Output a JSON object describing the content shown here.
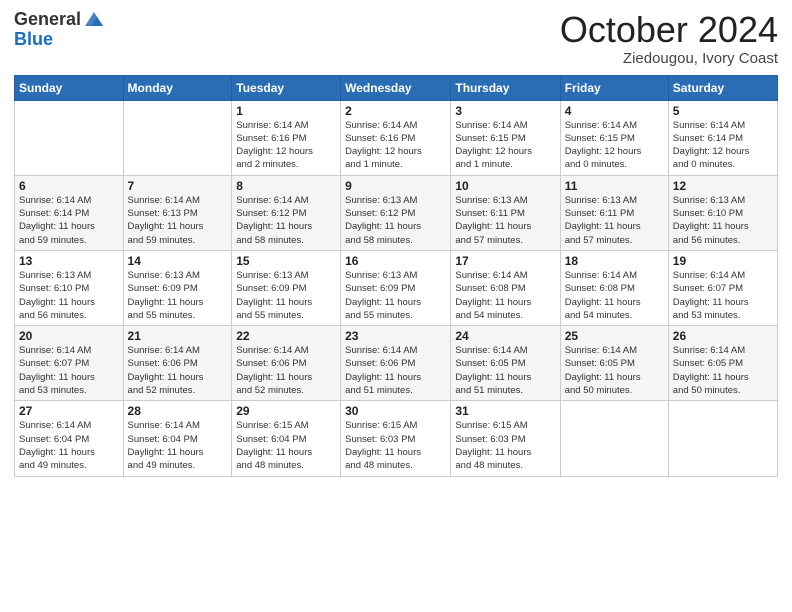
{
  "header": {
    "logo_general": "General",
    "logo_blue": "Blue",
    "month_title": "October 2024",
    "location": "Ziedougou, Ivory Coast"
  },
  "weekdays": [
    "Sunday",
    "Monday",
    "Tuesday",
    "Wednesday",
    "Thursday",
    "Friday",
    "Saturday"
  ],
  "weeks": [
    [
      {
        "day": "",
        "info": ""
      },
      {
        "day": "",
        "info": ""
      },
      {
        "day": "1",
        "info": "Sunrise: 6:14 AM\nSunset: 6:16 PM\nDaylight: 12 hours\nand 2 minutes."
      },
      {
        "day": "2",
        "info": "Sunrise: 6:14 AM\nSunset: 6:16 PM\nDaylight: 12 hours\nand 1 minute."
      },
      {
        "day": "3",
        "info": "Sunrise: 6:14 AM\nSunset: 6:15 PM\nDaylight: 12 hours\nand 1 minute."
      },
      {
        "day": "4",
        "info": "Sunrise: 6:14 AM\nSunset: 6:15 PM\nDaylight: 12 hours\nand 0 minutes."
      },
      {
        "day": "5",
        "info": "Sunrise: 6:14 AM\nSunset: 6:14 PM\nDaylight: 12 hours\nand 0 minutes."
      }
    ],
    [
      {
        "day": "6",
        "info": "Sunrise: 6:14 AM\nSunset: 6:14 PM\nDaylight: 11 hours\nand 59 minutes."
      },
      {
        "day": "7",
        "info": "Sunrise: 6:14 AM\nSunset: 6:13 PM\nDaylight: 11 hours\nand 59 minutes."
      },
      {
        "day": "8",
        "info": "Sunrise: 6:14 AM\nSunset: 6:12 PM\nDaylight: 11 hours\nand 58 minutes."
      },
      {
        "day": "9",
        "info": "Sunrise: 6:13 AM\nSunset: 6:12 PM\nDaylight: 11 hours\nand 58 minutes."
      },
      {
        "day": "10",
        "info": "Sunrise: 6:13 AM\nSunset: 6:11 PM\nDaylight: 11 hours\nand 57 minutes."
      },
      {
        "day": "11",
        "info": "Sunrise: 6:13 AM\nSunset: 6:11 PM\nDaylight: 11 hours\nand 57 minutes."
      },
      {
        "day": "12",
        "info": "Sunrise: 6:13 AM\nSunset: 6:10 PM\nDaylight: 11 hours\nand 56 minutes."
      }
    ],
    [
      {
        "day": "13",
        "info": "Sunrise: 6:13 AM\nSunset: 6:10 PM\nDaylight: 11 hours\nand 56 minutes."
      },
      {
        "day": "14",
        "info": "Sunrise: 6:13 AM\nSunset: 6:09 PM\nDaylight: 11 hours\nand 55 minutes."
      },
      {
        "day": "15",
        "info": "Sunrise: 6:13 AM\nSunset: 6:09 PM\nDaylight: 11 hours\nand 55 minutes."
      },
      {
        "day": "16",
        "info": "Sunrise: 6:13 AM\nSunset: 6:09 PM\nDaylight: 11 hours\nand 55 minutes."
      },
      {
        "day": "17",
        "info": "Sunrise: 6:14 AM\nSunset: 6:08 PM\nDaylight: 11 hours\nand 54 minutes."
      },
      {
        "day": "18",
        "info": "Sunrise: 6:14 AM\nSunset: 6:08 PM\nDaylight: 11 hours\nand 54 minutes."
      },
      {
        "day": "19",
        "info": "Sunrise: 6:14 AM\nSunset: 6:07 PM\nDaylight: 11 hours\nand 53 minutes."
      }
    ],
    [
      {
        "day": "20",
        "info": "Sunrise: 6:14 AM\nSunset: 6:07 PM\nDaylight: 11 hours\nand 53 minutes."
      },
      {
        "day": "21",
        "info": "Sunrise: 6:14 AM\nSunset: 6:06 PM\nDaylight: 11 hours\nand 52 minutes."
      },
      {
        "day": "22",
        "info": "Sunrise: 6:14 AM\nSunset: 6:06 PM\nDaylight: 11 hours\nand 52 minutes."
      },
      {
        "day": "23",
        "info": "Sunrise: 6:14 AM\nSunset: 6:06 PM\nDaylight: 11 hours\nand 51 minutes."
      },
      {
        "day": "24",
        "info": "Sunrise: 6:14 AM\nSunset: 6:05 PM\nDaylight: 11 hours\nand 51 minutes."
      },
      {
        "day": "25",
        "info": "Sunrise: 6:14 AM\nSunset: 6:05 PM\nDaylight: 11 hours\nand 50 minutes."
      },
      {
        "day": "26",
        "info": "Sunrise: 6:14 AM\nSunset: 6:05 PM\nDaylight: 11 hours\nand 50 minutes."
      }
    ],
    [
      {
        "day": "27",
        "info": "Sunrise: 6:14 AM\nSunset: 6:04 PM\nDaylight: 11 hours\nand 49 minutes."
      },
      {
        "day": "28",
        "info": "Sunrise: 6:14 AM\nSunset: 6:04 PM\nDaylight: 11 hours\nand 49 minutes."
      },
      {
        "day": "29",
        "info": "Sunrise: 6:15 AM\nSunset: 6:04 PM\nDaylight: 11 hours\nand 48 minutes."
      },
      {
        "day": "30",
        "info": "Sunrise: 6:15 AM\nSunset: 6:03 PM\nDaylight: 11 hours\nand 48 minutes."
      },
      {
        "day": "31",
        "info": "Sunrise: 6:15 AM\nSunset: 6:03 PM\nDaylight: 11 hours\nand 48 minutes."
      },
      {
        "day": "",
        "info": ""
      },
      {
        "day": "",
        "info": ""
      }
    ]
  ]
}
